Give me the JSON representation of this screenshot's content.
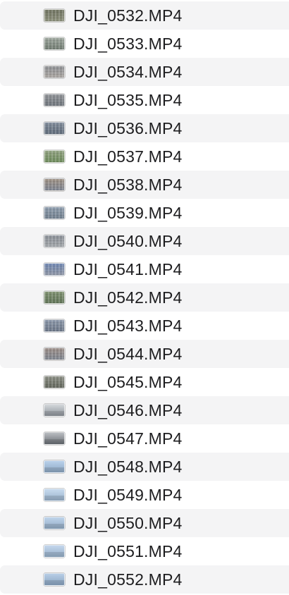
{
  "files": [
    {
      "name": "DJI_0532.MP4",
      "thumb_colors": [
        "#6f7260",
        "#8b8f7a"
      ],
      "thumb_kind": "aerial"
    },
    {
      "name": "DJI_0533.MP4",
      "thumb_colors": [
        "#9aa39a",
        "#6f7a70"
      ],
      "thumb_kind": "aerial"
    },
    {
      "name": "DJI_0534.MP4",
      "thumb_colors": [
        "#8d8f93",
        "#a9a4a0"
      ],
      "thumb_kind": "aerial"
    },
    {
      "name": "DJI_0535.MP4",
      "thumb_colors": [
        "#8f9296",
        "#6d737a"
      ],
      "thumb_kind": "aerial"
    },
    {
      "name": "DJI_0536.MP4",
      "thumb_colors": [
        "#7f8a99",
        "#5d6977"
      ],
      "thumb_kind": "aerial"
    },
    {
      "name": "DJI_0537.MP4",
      "thumb_colors": [
        "#8fa07f",
        "#6c8a5a"
      ],
      "thumb_kind": "aerial"
    },
    {
      "name": "DJI_0538.MP4",
      "thumb_colors": [
        "#9c8f82",
        "#7c8390"
      ],
      "thumb_kind": "aerial"
    },
    {
      "name": "DJI_0539.MP4",
      "thumb_colors": [
        "#8d9cac",
        "#6f7d8c"
      ],
      "thumb_kind": "aerial"
    },
    {
      "name": "DJI_0540.MP4",
      "thumb_colors": [
        "#8a8f96",
        "#a0a4a8"
      ],
      "thumb_kind": "aerial"
    },
    {
      "name": "DJI_0541.MP4",
      "thumb_colors": [
        "#6f86b0",
        "#8c93a3"
      ],
      "thumb_kind": "aerial"
    },
    {
      "name": "DJI_0542.MP4",
      "thumb_colors": [
        "#7d8f6f",
        "#5f7356"
      ],
      "thumb_kind": "aerial"
    },
    {
      "name": "DJI_0543.MP4",
      "thumb_colors": [
        "#8a96a8",
        "#6a7586"
      ],
      "thumb_kind": "aerial"
    },
    {
      "name": "DJI_0544.MP4",
      "thumb_colors": [
        "#9a8c86",
        "#7d848e"
      ],
      "thumb_kind": "aerial"
    },
    {
      "name": "DJI_0545.MP4",
      "thumb_colors": [
        "#8b8e84",
        "#5f6359"
      ],
      "thumb_kind": "aerial"
    },
    {
      "name": "DJI_0546.MP4",
      "thumb_colors": [
        "#d2d6da",
        "#8e949b"
      ],
      "thumb_kind": "sky"
    },
    {
      "name": "DJI_0547.MP4",
      "thumb_colors": [
        "#b9bcc0",
        "#6a6f75"
      ],
      "thumb_kind": "sky"
    },
    {
      "name": "DJI_0548.MP4",
      "thumb_colors": [
        "#b8d0ea",
        "#8ea8c4"
      ],
      "thumb_kind": "sky"
    },
    {
      "name": "DJI_0549.MP4",
      "thumb_colors": [
        "#c7daee",
        "#9ab3cc"
      ],
      "thumb_kind": "sky"
    },
    {
      "name": "DJI_0550.MP4",
      "thumb_colors": [
        "#bed3ea",
        "#92acc6"
      ],
      "thumb_kind": "sky"
    },
    {
      "name": "DJI_0551.MP4",
      "thumb_colors": [
        "#c3d6ec",
        "#96b0ca"
      ],
      "thumb_kind": "sky"
    },
    {
      "name": "DJI_0552.MP4",
      "thumb_colors": [
        "#b7cde6",
        "#8aa5c1"
      ],
      "thumb_kind": "sky"
    }
  ],
  "row_stripe_color": "#f4f4f5",
  "text_color": "#1d1d1f"
}
